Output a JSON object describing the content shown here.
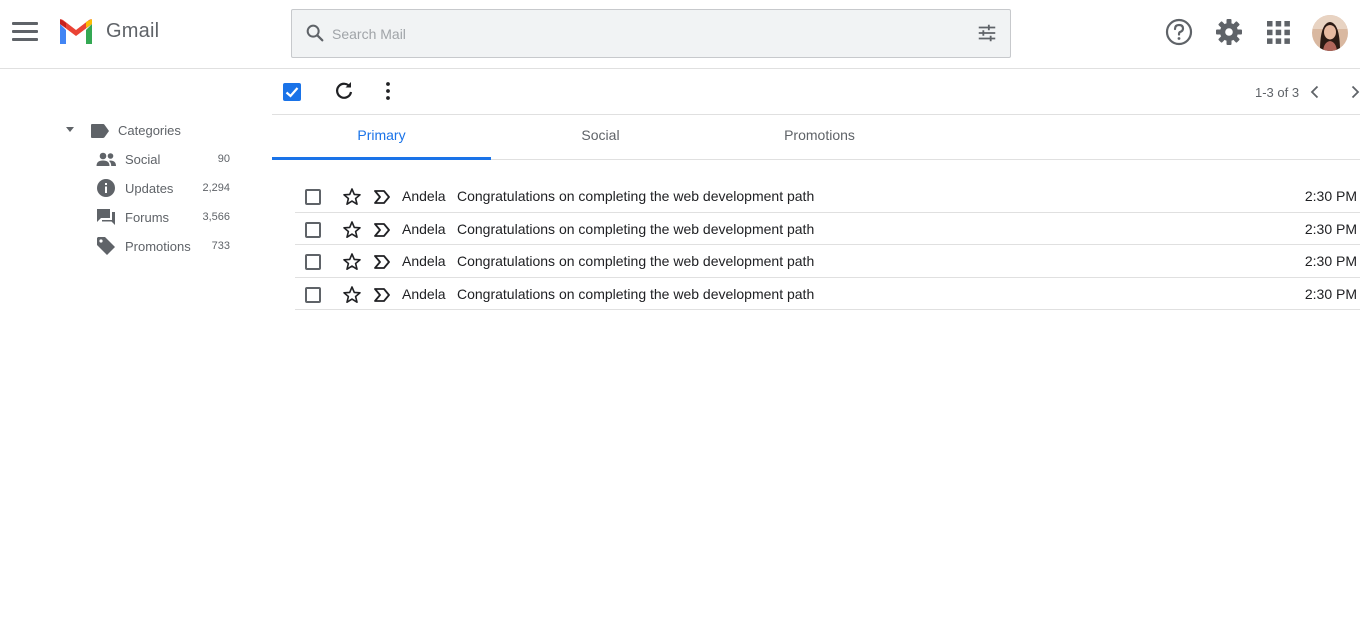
{
  "header": {
    "app_name": "Gmail",
    "search_placeholder": "Search Mail",
    "icons": [
      "menu-icon",
      "gmail-logo",
      "search-icon",
      "tune-icon",
      "help-icon",
      "gear-icon",
      "apps-icon",
      "avatar"
    ]
  },
  "sidebar": {
    "categories_label": "Categories",
    "items": [
      {
        "label": "Social",
        "count": "90",
        "icon": "people-icon"
      },
      {
        "label": "Updates",
        "count": "2,294",
        "icon": "info-icon"
      },
      {
        "label": "Forums",
        "count": "3,566",
        "icon": "forum-icon"
      },
      {
        "label": "Promotions",
        "count": "733",
        "icon": "tag-icon"
      }
    ]
  },
  "toolbar": {
    "pager_text": "1-3 of 3",
    "select_all_checked": true
  },
  "tabs": [
    {
      "label": "Primary",
      "active": true
    },
    {
      "label": "Social",
      "active": false
    },
    {
      "label": "Promotions",
      "active": false
    }
  ],
  "emails": [
    {
      "sender": "Andela",
      "subject": "Congratulations on completing the web development path",
      "time": "2:30 PM"
    },
    {
      "sender": "Andela",
      "subject": "Congratulations on completing the web development path",
      "time": "2:30 PM"
    },
    {
      "sender": "Andela",
      "subject": "Congratulations on completing the web development path",
      "time": "2:30 PM"
    },
    {
      "sender": "Andela",
      "subject": "Congratulations on completing the web development path",
      "time": "2:30 PM"
    }
  ],
  "colors": {
    "accent": "#1a73e8",
    "icon_gray": "#5f6368",
    "search_bg": "#f1f3f4",
    "divider": "#e0e0e0"
  }
}
